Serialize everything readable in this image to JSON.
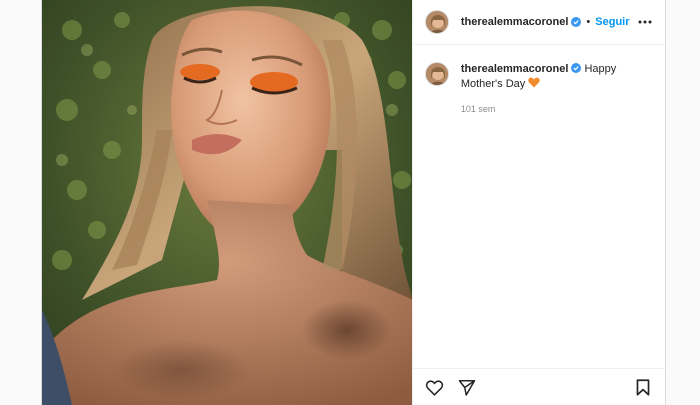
{
  "post": {
    "author": "therealemmacoronel",
    "follow_label": "Seguir",
    "separator": "•",
    "caption_author": "therealemmacoronel",
    "caption_text": "Happy Mother's Day",
    "timestamp": "101 sem",
    "photo_description": "Selfie of a woman with orange eyeshadow, eyes closed, long blonde hair, in front of a green leafy wall"
  },
  "icons": {
    "verified": "verified-badge-icon",
    "more": "more-options-icon",
    "like": "heart-outline-icon",
    "share": "paper-plane-icon",
    "save": "bookmark-icon",
    "emoji": "orange-heart-emoji"
  },
  "colors": {
    "follow": "#0095f6",
    "verified": "#3897f0",
    "emoji_heart": "#f28b2d",
    "text": "#262626",
    "muted": "#8e8e8e"
  }
}
